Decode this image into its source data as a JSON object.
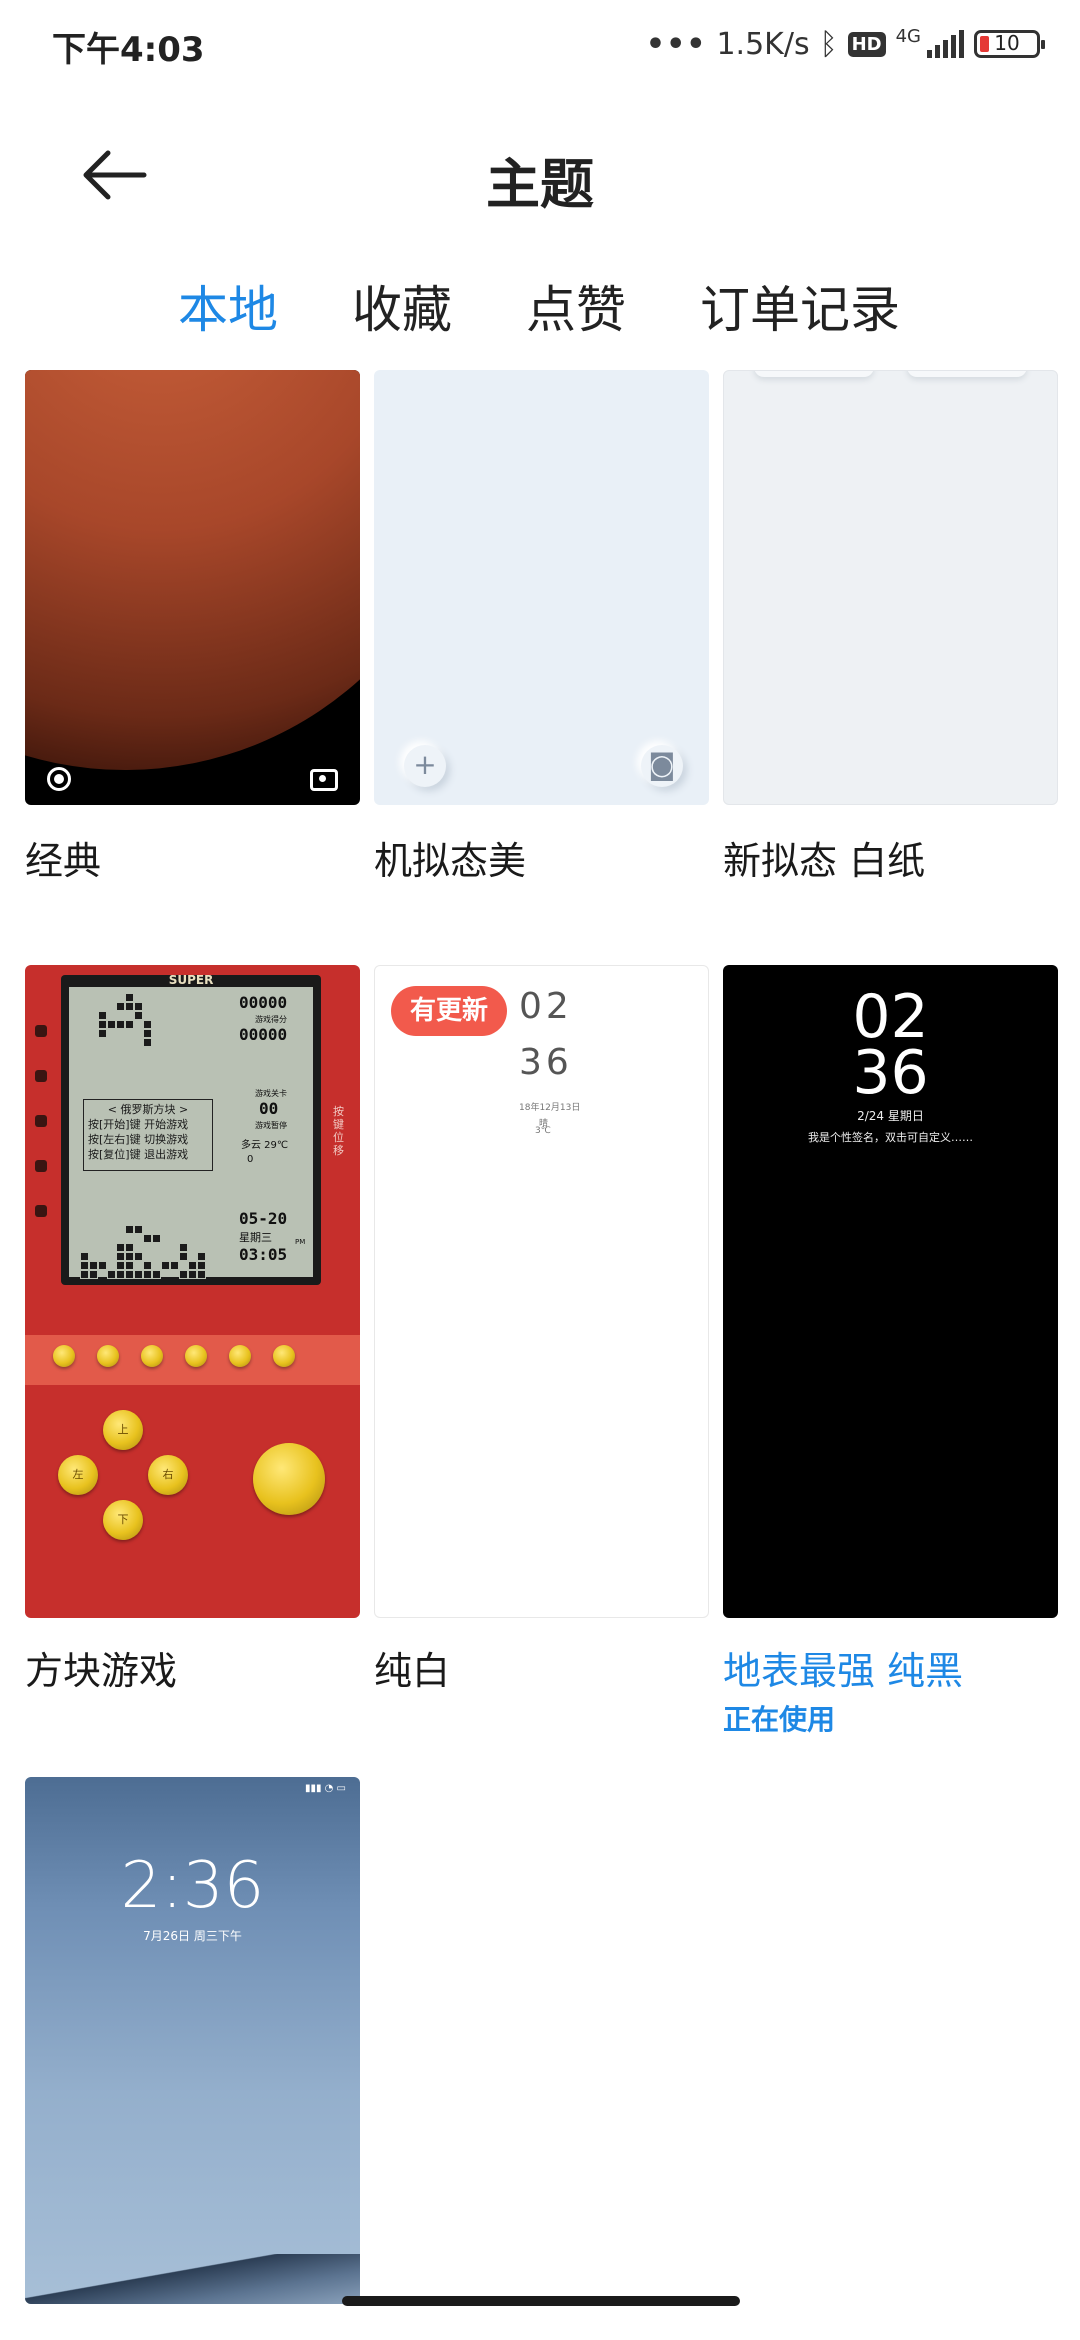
{
  "status_bar": {
    "time": "下午4:03",
    "net_speed": "1.5K/s",
    "hd": "HD",
    "network": "4G",
    "battery": "10"
  },
  "header": {
    "title": "主题"
  },
  "tabs": [
    {
      "label": "本地",
      "active": true
    },
    {
      "label": "收藏",
      "active": false
    },
    {
      "label": "点赞",
      "active": false
    },
    {
      "label": "订单记录",
      "active": false
    }
  ],
  "themes": [
    {
      "name": "经典"
    },
    {
      "name": "机拟态美"
    },
    {
      "name": "新拟态 白纸"
    },
    {
      "name": "方块游戏",
      "preview": {
        "brand": "SUPER",
        "score1": "00000",
        "score_label": "游戏得分",
        "score2": "00000",
        "level_label": "游戏关卡",
        "level": "00",
        "pause_label": "游戏暂停",
        "menu_title": "< 俄罗斯方块 >",
        "menu_lines": [
          "按[开始]键  开始游戏",
          "按[左右]键  切换游戏",
          "按[复位]键  退出游戏"
        ],
        "weather": "多云  29℃",
        "steps": "0",
        "date": "05-20",
        "weekday": "星期三",
        "ampm": "PM",
        "clock": "03:05",
        "side_hint": "按键位移",
        "dpad": {
          "up": "上",
          "left": "左",
          "right": "右",
          "down": "下"
        }
      }
    },
    {
      "name": "纯白",
      "badge": "有更新",
      "preview": {
        "hour": "02",
        "minute": "36",
        "date": "18年12月13日",
        "weather": "晴",
        "temp": "3℃"
      }
    },
    {
      "name": "地表最强 纯黑",
      "status": "正在使用",
      "preview": {
        "hour": "02",
        "minute": "36",
        "date": "2/24  星期日",
        "signature": "我是个性签名，双击可自定义……"
      }
    },
    {
      "name": "",
      "preview": {
        "time": "2:36",
        "date": "7月26日 周三下午"
      }
    }
  ]
}
